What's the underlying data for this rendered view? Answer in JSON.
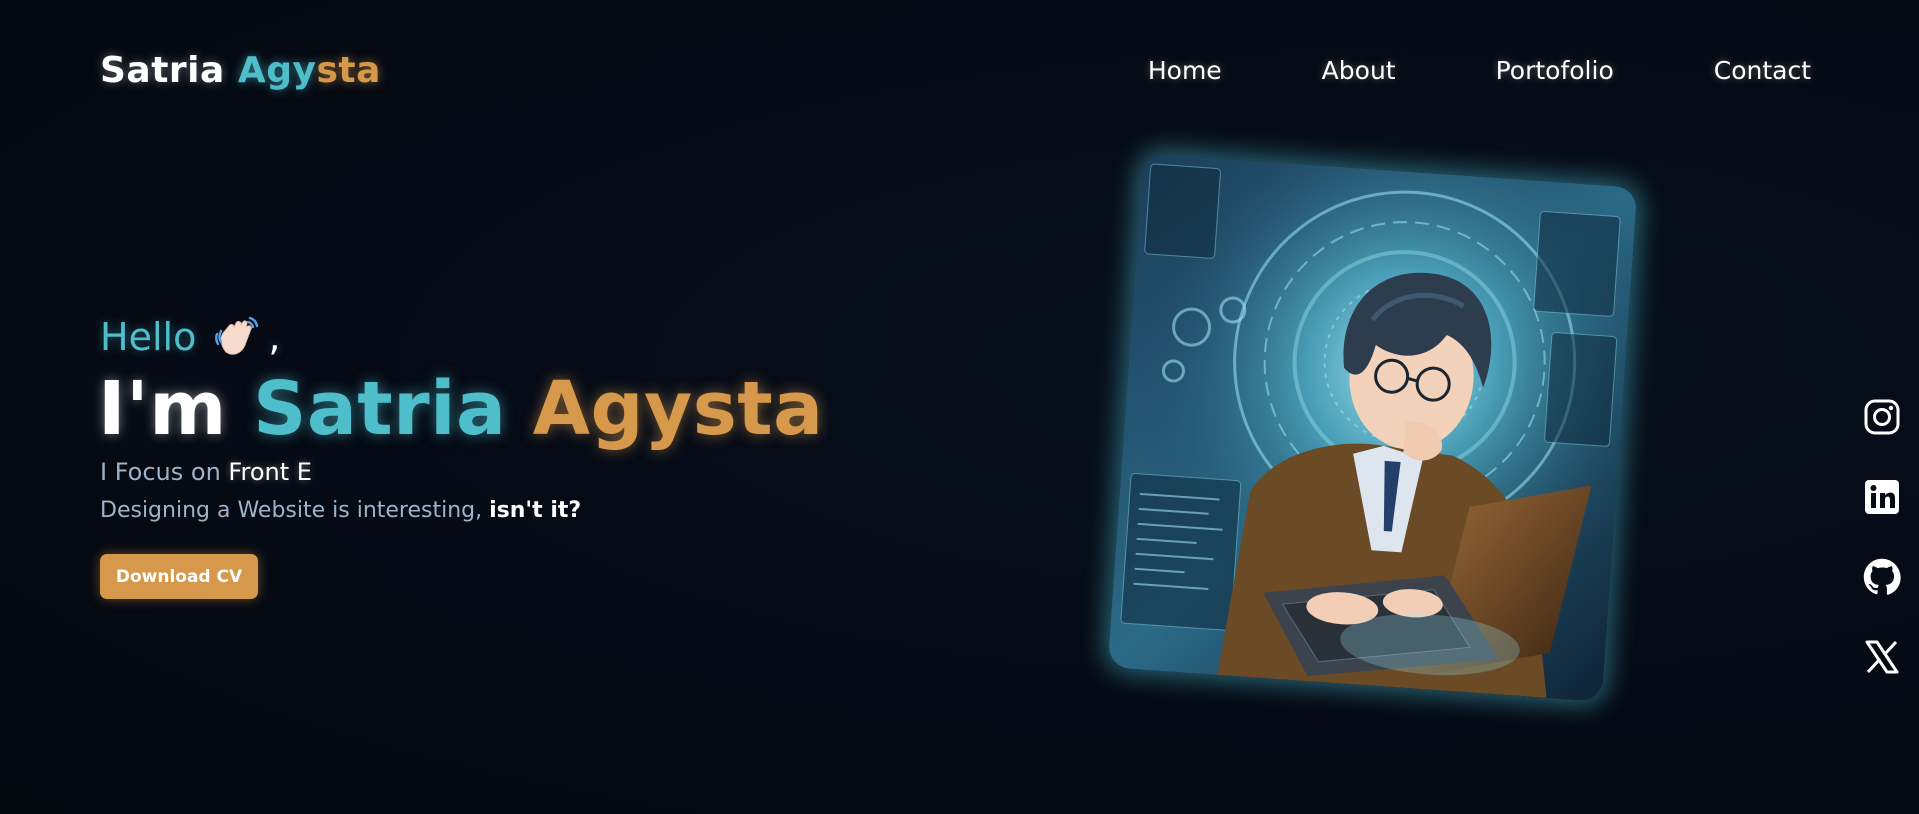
{
  "header": {
    "logo_first": "Satria",
    "logo_last_a": "Agy",
    "logo_last_b": "sta",
    "nav": [
      {
        "label": "Home"
      },
      {
        "label": "About"
      },
      {
        "label": "Portofolio"
      },
      {
        "label": "Contact"
      }
    ]
  },
  "hero": {
    "hello": "Hello",
    "hello_icon": "waving-hand-icon",
    "comma": ",",
    "im": "I'm",
    "first_name": "Satria",
    "last_name": "Agysta",
    "focus_label": "I Focus on",
    "focus_role": "Front E",
    "tagline_main": "Designing a Website is interesting,",
    "tagline_emph": "isn't it?",
    "cv_button": "Download CV",
    "image_icon": "anime-programmer-illustration"
  },
  "social": [
    {
      "icon": "instagram-icon"
    },
    {
      "icon": "linkedin-icon"
    },
    {
      "icon": "github-icon"
    },
    {
      "icon": "x-twitter-icon"
    }
  ],
  "colors": {
    "background": "#050a14",
    "accent_teal": "#4fbecb",
    "accent_gold": "#d6984a",
    "muted_text": "#9fb3c8"
  }
}
